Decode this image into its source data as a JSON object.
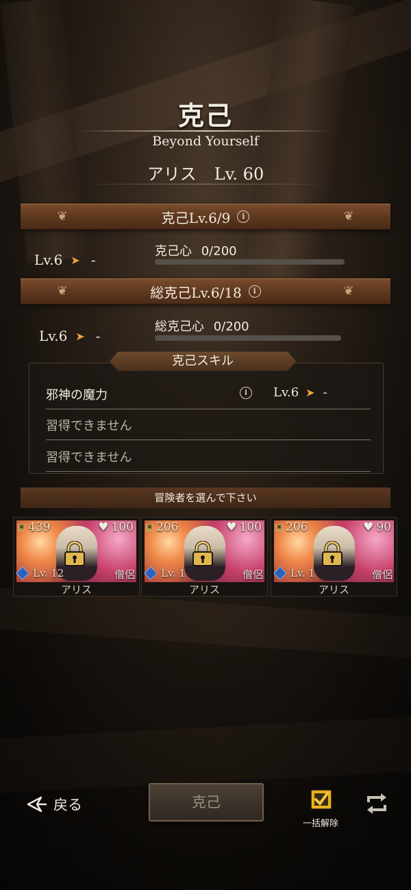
{
  "header": {
    "title": "克己",
    "subtitle": "Beyond Yourself",
    "character_name": "アリス",
    "character_level": "Lv. 60"
  },
  "limit_break": {
    "banner": "克己Lv.6/9",
    "current_level": "Lv.6",
    "next_level": "-",
    "progress_label": "克己心",
    "progress_value": "0/200",
    "progress_fraction": 0
  },
  "total_limit_break": {
    "banner": "総克己Lv.6/18",
    "current_level": "Lv.6",
    "next_level": "-",
    "progress_label": "総克己心",
    "progress_value": "0/200",
    "progress_fraction": 0
  },
  "skills": {
    "tab_label": "克己スキル",
    "rows": [
      {
        "name": "邪神の魔力",
        "current_level": "Lv.6",
        "next_level": "-"
      },
      {
        "name": "習得できません"
      },
      {
        "name": "習得できません"
      }
    ]
  },
  "adventurer_select": {
    "banner": "冒険者を選んで下さい",
    "cards": [
      {
        "power": "439",
        "affection": "100",
        "level": "Lv. 12",
        "job": "僧侶",
        "name": "アリス"
      },
      {
        "power": "206",
        "affection": "100",
        "level": "Lv. 1",
        "job": "僧侶",
        "name": "アリス"
      },
      {
        "power": "206",
        "affection": "90",
        "level": "Lv. 1",
        "job": "僧侶",
        "name": "アリス"
      }
    ]
  },
  "footer": {
    "back_label": "戻る",
    "main_button_label": "克己",
    "bulk_release_label": "一括解除"
  },
  "icons": {
    "arrow": "chevron-right-icon",
    "info": "info-icon",
    "lock": "lock-icon",
    "heart": "heart-icon",
    "back": "back-arrow-icon",
    "checkbox": "checkbox-icon",
    "refresh": "refresh-icon"
  },
  "colors": {
    "banner": "#5e381f",
    "arrow": "#f1a53a",
    "checkbox": "#e8b020"
  }
}
